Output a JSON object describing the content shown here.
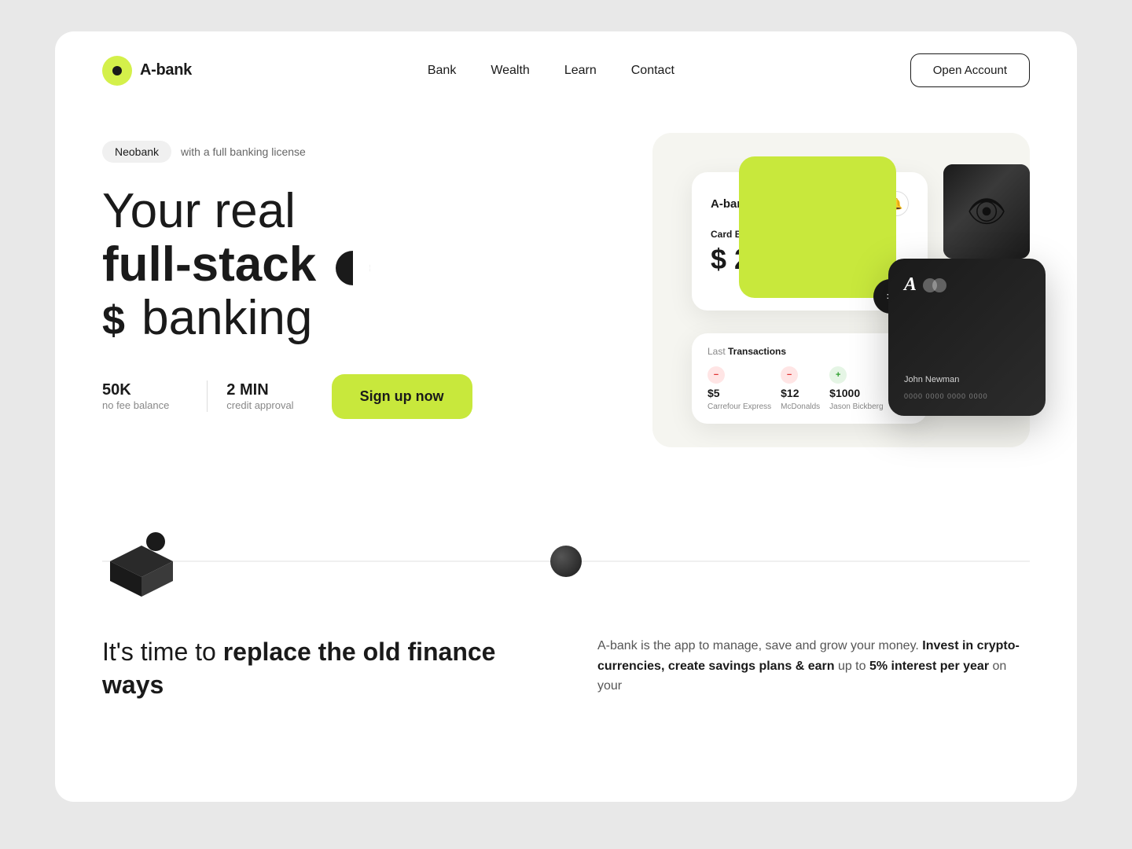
{
  "meta": {
    "title": "A-bank - Your real full-stack banking"
  },
  "navbar": {
    "logo_text": "A-bank",
    "nav_items": [
      {
        "label": "Bank",
        "href": "#"
      },
      {
        "label": "Wealth",
        "href": "#"
      },
      {
        "label": "Learn",
        "href": "#"
      },
      {
        "label": "Contact",
        "href": "#"
      }
    ],
    "cta_button": "Open Account"
  },
  "hero": {
    "badge_label": "Neobank",
    "badge_subtitle": "with a full banking license",
    "headline_line1": "Your real",
    "headline_line2": "full-stack",
    "headline_line3": "banking",
    "stats": [
      {
        "number": "50K",
        "label": "no fee balance"
      },
      {
        "number": "2 MIN",
        "label": "credit approval"
      }
    ],
    "signup_button": "Sign up now"
  },
  "card_ui": {
    "brand": "A-bank",
    "balance_label": "Card",
    "balance_label_bold": "Balance",
    "balance_amount": "$ 25 354",
    "transactions_label": "Last",
    "transactions_label_bold": "Transactions",
    "transactions": [
      {
        "type": "minus",
        "amount": "$5",
        "name": "Carrefour Express"
      },
      {
        "type": "minus",
        "amount": "$12",
        "name": "McDonalds"
      },
      {
        "type": "plus",
        "amount": "$1000",
        "name": "Jason Bickberg"
      }
    ],
    "dark_card": {
      "holder": "John Newman",
      "number": "0000  0000  0000  0000"
    }
  },
  "lower": {
    "left_heading_normal": "It's time to",
    "left_heading_bold": "replace the old finance ways",
    "right_body_part1": "A-bank is the app to manage, save and grow your money.",
    "right_body_highlight": "Invest in crypto-currencies, create savings plans & earn",
    "right_body_part2": "up to 5%",
    "right_body_highlight2": "interest per year",
    "right_body_part3": "on your"
  },
  "colors": {
    "accent_green": "#c8e83c",
    "dark": "#1a1a1a",
    "light_bg": "#f5f5f0"
  }
}
